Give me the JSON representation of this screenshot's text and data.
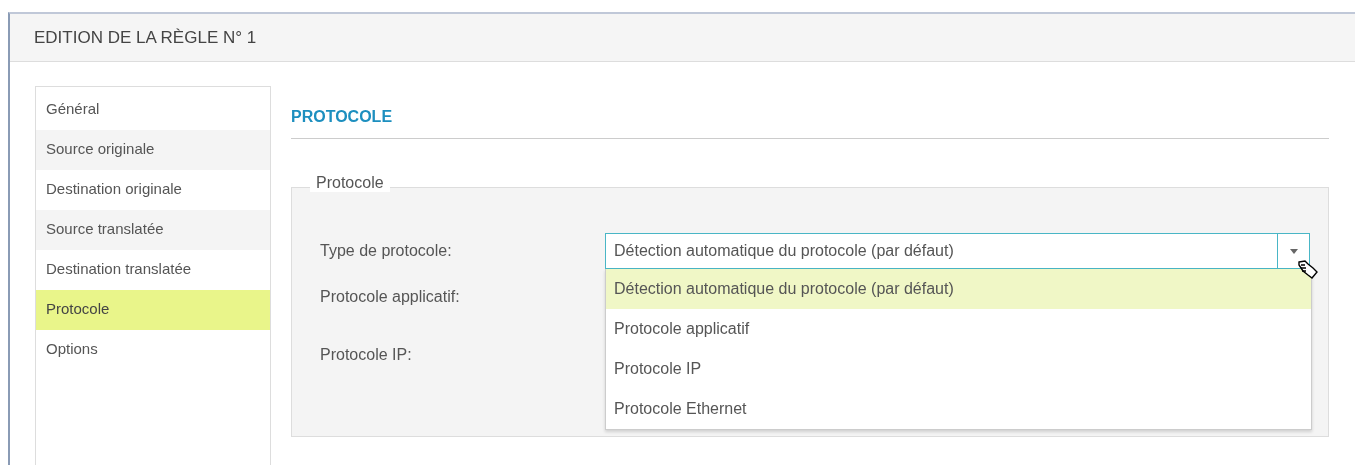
{
  "window": {
    "title": "EDITION DE LA RÈGLE N° 1"
  },
  "sidebar": {
    "items": [
      {
        "label": "Général",
        "selected": false
      },
      {
        "label": "Source originale",
        "selected": false
      },
      {
        "label": "Destination originale",
        "selected": false
      },
      {
        "label": "Source translatée",
        "selected": false
      },
      {
        "label": "Destination translatée",
        "selected": false
      },
      {
        "label": "Protocole",
        "selected": true
      },
      {
        "label": "Options",
        "selected": false
      }
    ]
  },
  "section": {
    "title": "PROTOCOLE",
    "group": {
      "legend": "Protocole",
      "fields": [
        {
          "label": "Type de protocole:",
          "value": "Détection automatique du protocole (par défaut)",
          "expanded": true,
          "options": [
            {
              "label": "Détection automatique du protocole (par défaut)",
              "selected": true
            },
            {
              "label": "Protocole applicatif",
              "selected": false
            },
            {
              "label": "Protocole IP",
              "selected": false
            },
            {
              "label": "Protocole Ethernet",
              "selected": false
            }
          ]
        },
        {
          "label": "Protocole applicatif:"
        },
        {
          "label": "Protocole IP:"
        }
      ]
    }
  }
}
